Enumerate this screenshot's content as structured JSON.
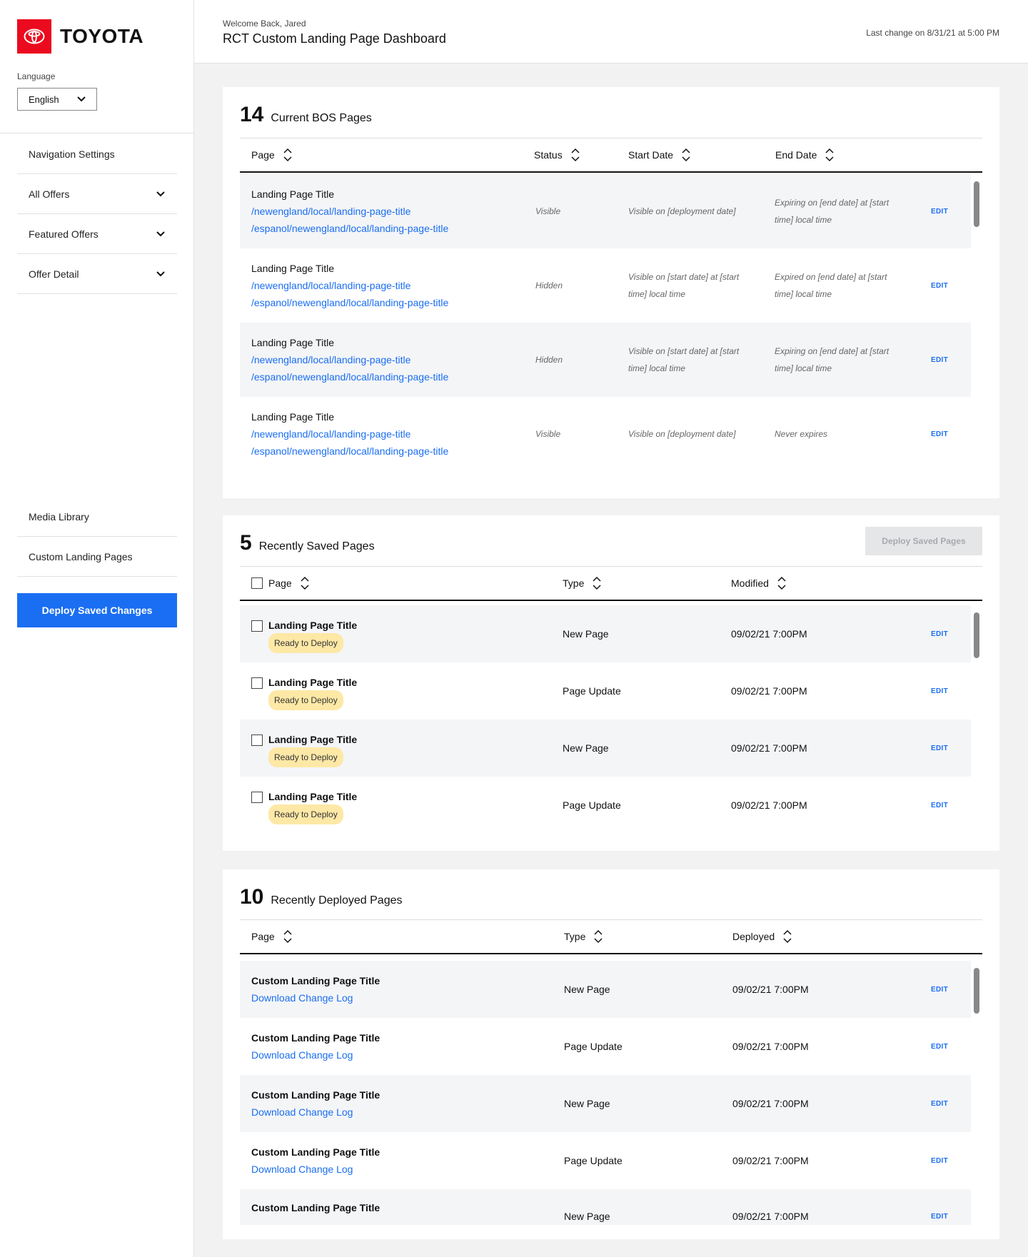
{
  "sidebar": {
    "brand": {
      "name": "TOYOTA",
      "color": "#eb0a1e"
    },
    "language": {
      "label": "Language",
      "selected": "English"
    },
    "nav_items": [
      {
        "label": "Navigation Settings",
        "has_chevron": false
      },
      {
        "label": "All Offers",
        "has_chevron": true
      },
      {
        "label": "Featured Offers",
        "has_chevron": true
      },
      {
        "label": "Offer Detail",
        "has_chevron": true
      }
    ],
    "bottom_items": [
      {
        "label": "Media Library"
      },
      {
        "label": "Custom Landing Pages"
      }
    ],
    "deploy_button": "Deploy Saved Changes"
  },
  "header": {
    "welcome": "Welcome Back, Jared",
    "title": "RCT Custom Landing Page Dashboard",
    "last_change": "Last change on 8/31/21 at 5:00 PM"
  },
  "current": {
    "count": "14",
    "title": "Current BOS Pages",
    "columns": [
      "Page",
      "Status",
      "Start Date",
      "End Date"
    ],
    "rows": [
      {
        "title": "Landing Page Title",
        "url_en": "/newengland/local/landing-page-title",
        "url_es": "/espanol/newengland/local/landing-page-title",
        "status": "Visible",
        "start": "Visible on [deployment date]",
        "end": "Expiring on [end date] at [start time] local time",
        "edit": "EDIT"
      },
      {
        "title": "Landing Page Title",
        "url_en": "/newengland/local/landing-page-title",
        "url_es": "/espanol/newengland/local/landing-page-title",
        "status": "Hidden",
        "start": "Visible on [start date] at [start time] local time",
        "end": "Expired on [end date] at [start time] local time",
        "edit": "EDIT"
      },
      {
        "title": "Landing Page Title",
        "url_en": "/newengland/local/landing-page-title",
        "url_es": "/espanol/newengland/local/landing-page-title",
        "status": "Hidden",
        "start": "Visible on [start date] at [start time] local time",
        "end": "Expiring on [end date] at [start time] local time",
        "edit": "EDIT"
      },
      {
        "title": "Landing Page Title",
        "url_en": "/newengland/local/landing-page-title",
        "url_es": "/espanol/newengland/local/landing-page-title",
        "status": "Visible",
        "start": "Visible on [deployment date]",
        "end": "Never expires",
        "edit": "EDIT"
      }
    ]
  },
  "saved": {
    "count": "5",
    "title": "Recently Saved Pages",
    "deploy_button": "Deploy Saved Pages",
    "columns": [
      "Page",
      "Type",
      "Modified"
    ],
    "rows": [
      {
        "title": "Landing Page Title",
        "badge": "Ready to Deploy",
        "type": "New Page",
        "modified": "09/02/21 7:00PM",
        "edit": "EDIT"
      },
      {
        "title": "Landing Page Title",
        "badge": "Ready to Deploy",
        "type": "Page Update",
        "modified": "09/02/21 7:00PM",
        "edit": "EDIT"
      },
      {
        "title": "Landing Page Title",
        "badge": "Ready to Deploy",
        "type": "New Page",
        "modified": "09/02/21 7:00PM",
        "edit": "EDIT"
      },
      {
        "title": "Landing Page Title",
        "badge": "Ready to Deploy",
        "type": "Page Update",
        "modified": "09/02/21 7:00PM",
        "edit": "EDIT"
      }
    ]
  },
  "deployed": {
    "count": "10",
    "title": "Recently Deployed Pages",
    "columns": [
      "Page",
      "Type",
      "Deployed"
    ],
    "rows": [
      {
        "title": "Custom Landing Page Title",
        "link": "Download Change Log",
        "type": "New Page",
        "deployed": "09/02/21 7:00PM",
        "edit": "EDIT"
      },
      {
        "title": "Custom Landing Page Title",
        "link": "Download Change Log",
        "type": "Page Update",
        "deployed": "09/02/21 7:00PM",
        "edit": "EDIT"
      },
      {
        "title": "Custom Landing Page Title",
        "link": "Download Change Log",
        "type": "New Page",
        "deployed": "09/02/21 7:00PM",
        "edit": "EDIT"
      },
      {
        "title": "Custom Landing Page Title",
        "link": "Download Change Log",
        "type": "Page Update",
        "deployed": "09/02/21 7:00PM",
        "edit": "EDIT"
      },
      {
        "title": "Custom Landing Page Title",
        "link": "",
        "type": "New Page",
        "deployed": "09/02/21 7:00PM",
        "edit": "EDIT"
      }
    ]
  },
  "colors": {
    "accent": "#1a6ef2",
    "brand": "#eb0a1e",
    "badge": "#fde8a6",
    "row_shade": "#f4f5f7"
  },
  "icons": {
    "sort": "sort-up-down-icon",
    "chevron": "chevron-down-icon",
    "logo": "toyota-logo-icon"
  }
}
